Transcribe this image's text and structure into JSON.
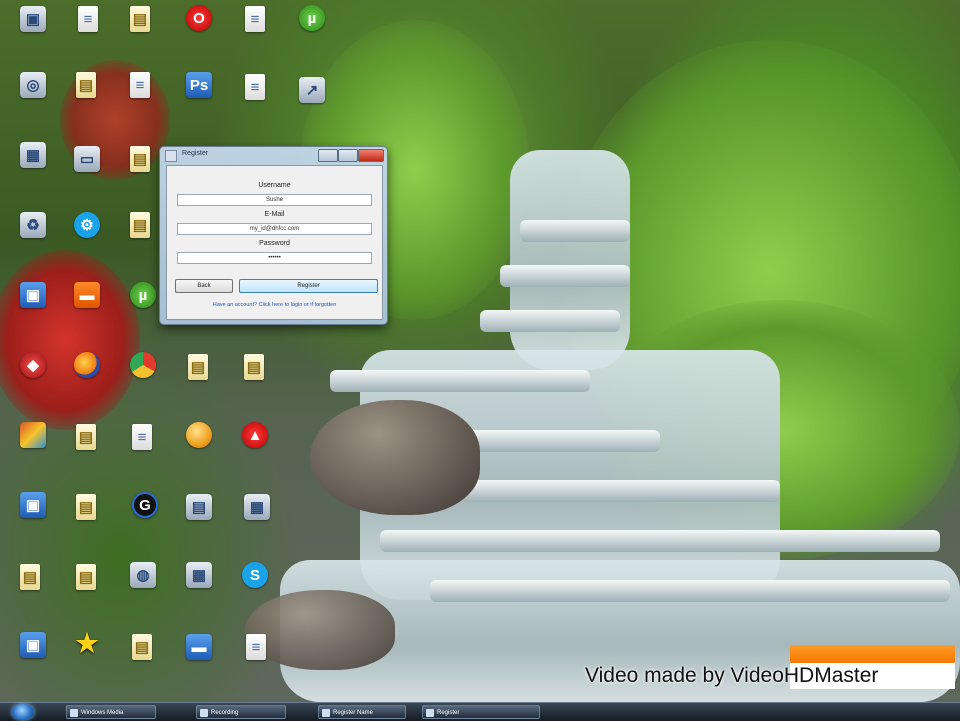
{
  "window": {
    "title": "Register",
    "username_label": "Username",
    "username_value": "Sushe",
    "email_label": "E-Mail",
    "email_value": "my_id@dhfcc.com",
    "password_label": "Password",
    "password_value": "••••••",
    "back_label": "Back",
    "register_label": "Register",
    "link_text": "Have an account? Click here to login or if forgotten"
  },
  "watermark": {
    "text": "Video made by VideoHDMaster"
  },
  "taskbar": {
    "tasks": [
      "Windows Media",
      "Recording",
      "Register Name",
      "Register"
    ]
  }
}
